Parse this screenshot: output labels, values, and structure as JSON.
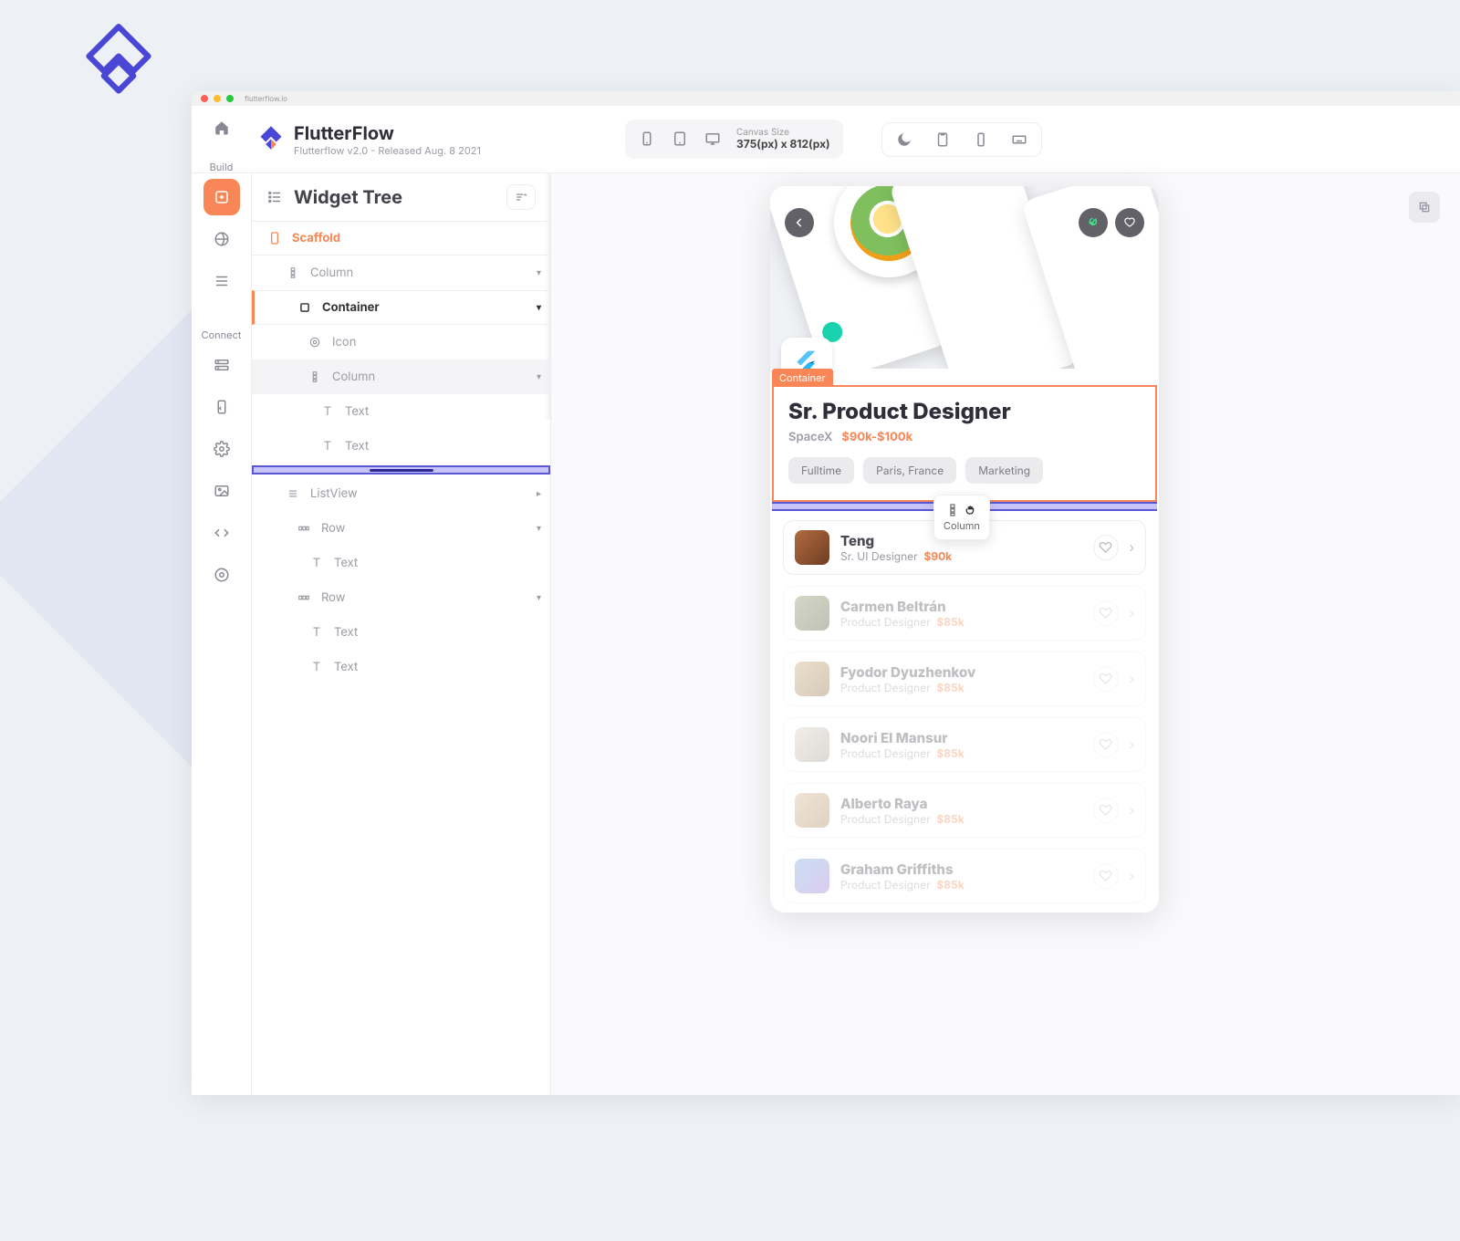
{
  "titlebar": {
    "title": "flutterflow.io"
  },
  "brand": {
    "name": "FlutterFlow",
    "subtitle": "Flutterflow v2.0 - Released Aug. 8 2021"
  },
  "canvas": {
    "label": "Canvas Size",
    "dims": "375(px) x 812(px)"
  },
  "rail": {
    "build": "Build",
    "connect": "Connect"
  },
  "panel": {
    "title": "Widget Tree"
  },
  "tree": {
    "scaffold": "Scaffold",
    "column1": "Column",
    "container": "Container",
    "icon": "Icon",
    "column2": "Column",
    "text1": "Text",
    "text2": "Text",
    "listview": "ListView",
    "row1": "Row",
    "text3": "Text",
    "row2": "Row",
    "text4": "Text",
    "text5": "Text"
  },
  "selTag": "Container",
  "dropHint": "Column",
  "job": {
    "title": "Sr. Product Designer",
    "company": "SpaceX",
    "salary": "$90k-$100k",
    "chip1": "Fulltime",
    "chip2": "Paris, France",
    "chip3": "Marketing"
  },
  "people": [
    {
      "name": "Teng",
      "role": "Sr. UI Designer",
      "sal": "$90k"
    },
    {
      "name": "Carmen Beltrán",
      "role": "Product Designer",
      "sal": "$85k"
    },
    {
      "name": "Fyodor Dyuzhenkov",
      "role": "Product Designer",
      "sal": "$85k"
    },
    {
      "name": "Noori El Mansur",
      "role": "Product Designer",
      "sal": "$85k"
    },
    {
      "name": "Alberto Raya",
      "role": "Product Designer",
      "sal": "$85k"
    },
    {
      "name": "Graham Griffiths",
      "role": "Product Designer",
      "sal": "$85k"
    }
  ]
}
